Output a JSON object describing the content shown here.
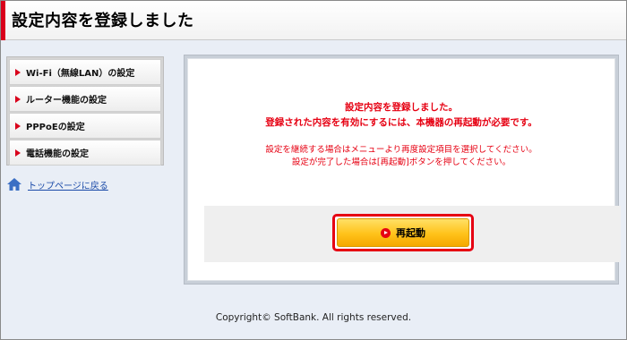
{
  "header": {
    "title": "設定内容を登録しました"
  },
  "menu": {
    "items": [
      {
        "label": "Wi-Fi（無線LAN）の設定"
      },
      {
        "label": "ルーター機能の設定"
      },
      {
        "label": "PPPoEの設定"
      },
      {
        "label": "電話機能の設定"
      }
    ]
  },
  "top_link": {
    "label": "トップページに戻る",
    "icon": "home-icon"
  },
  "panel": {
    "message_line1": "設定内容を登録しました。",
    "message_line2": "登録された内容を有効にするには、本機器の再起動が必要です。",
    "info_line1": "設定を継続する場合はメニューより再度設定項目を選択してください。",
    "info_line2": "設定が完了した場合は[再起動]ボタンを押してください。",
    "reboot_label": "再起動"
  },
  "footer": {
    "copyright": "Copyright© SoftBank. All rights reserved."
  },
  "colors": {
    "accent_red": "#e60012",
    "button_yellow": "#ffc21a",
    "link_blue": "#1a4aa8"
  }
}
